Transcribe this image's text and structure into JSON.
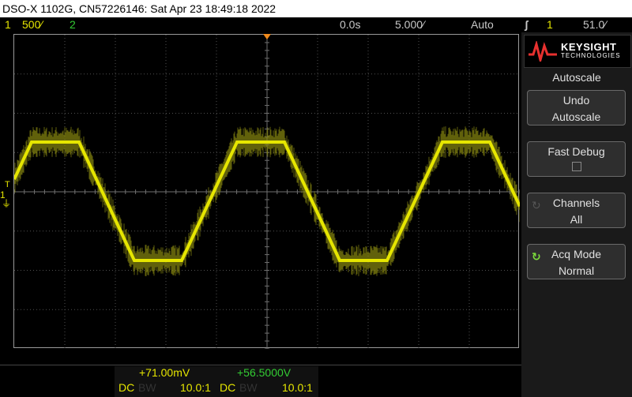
{
  "title": "DSO-X 1102G, CN57226146: Sat Apr 23 18:49:18 2022",
  "status": {
    "ch1_num": "1",
    "ch1_scale": "500 ̸/",
    "ch1_scale_text": "500∕",
    "ch2_num": "2",
    "time_offset": "0.0s",
    "time_scale": "5.000∕",
    "trigger_mode": "Auto",
    "trig_icon": "ƭ",
    "trig_source": "1",
    "trig_level": "51.0∕"
  },
  "markers": {
    "trigger_level": "T",
    "ch1": "1",
    "ground": "⏚"
  },
  "softpanel": {
    "brand": "KEYSIGHT",
    "brand_sub": "TECHNOLOGIES",
    "menu_title": "Autoscale",
    "keys": [
      {
        "line1": "Undo",
        "line2": "Autoscale"
      },
      {
        "line1": "Fast Debug",
        "line2": ""
      },
      {
        "line1": "Channels",
        "line2": "All"
      },
      {
        "line1": "Acq Mode",
        "line2": "Normal"
      }
    ]
  },
  "bottom": {
    "ch1": {
      "offset": "+71.00mV",
      "coupling": "DC",
      "bw": "BW",
      "probe": "10.0:1"
    },
    "ch2": {
      "offset": "+56.5000V",
      "coupling": "DC",
      "bw": "BW",
      "probe": "10.0:1"
    }
  },
  "colors": {
    "ch1": "#e6e600",
    "ch2": "#33cc33",
    "grid": "#505050",
    "trigger": "#f08a1c"
  },
  "waveform": {
    "shape": "trapezoid",
    "channel": "1",
    "periods_visible": 2.5
  }
}
